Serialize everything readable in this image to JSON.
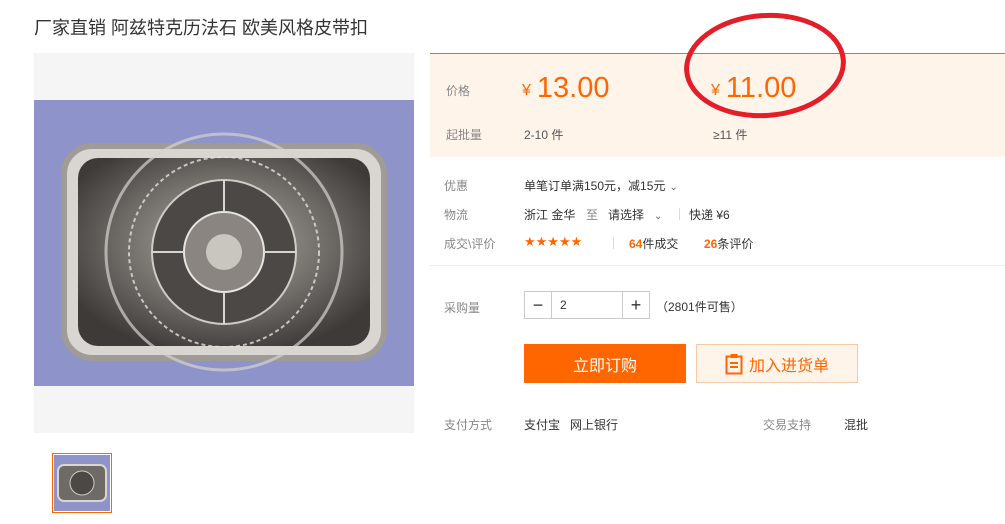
{
  "product": {
    "title": "厂家直销 阿兹特克历法石 欧美风格皮带扣"
  },
  "price_panel": {
    "price_label": "价格",
    "currency": "¥",
    "tiers": [
      {
        "price": "13.00",
        "range": "2-10 件"
      },
      {
        "price": "11.00",
        "range": "≥11 件"
      }
    ],
    "min_qty_label": "起批量"
  },
  "details": {
    "discount_label": "优惠",
    "discount_text": "单笔订单满150元，减15元",
    "logistics_label": "物流",
    "origin": "浙江 金华",
    "to_word": "至",
    "destination_select": "请选择",
    "shipping": "快递 ¥6",
    "sales_label": "成交\\评价",
    "stars": "★★★★★",
    "sales_count": "64",
    "sales_suffix": "件成交",
    "review_count": "26",
    "review_suffix": "条评价"
  },
  "purchase": {
    "qty_label": "采购量",
    "minus": "−",
    "plus": "+",
    "qty_value": "2",
    "available": "（2801件可售）",
    "order_button": "立即订购",
    "cart_button": "加入进货单"
  },
  "footer": {
    "payment_label": "支付方式",
    "payment_methods": "支付宝   网上银行",
    "trade_label": "交易支持",
    "trade_value": "混批"
  },
  "colors": {
    "accent": "#ff6600",
    "highlight_circle": "#e41e28"
  },
  "icons": {
    "cart_icon": "clipboard-icon",
    "discount_chevron": "chevron-down-icon",
    "destination_chevron": "chevron-down-icon"
  }
}
